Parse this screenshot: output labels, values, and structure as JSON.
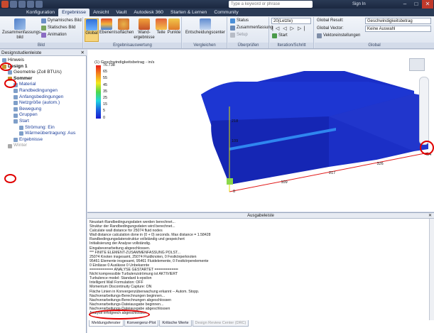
{
  "titlebar": {
    "search_placeholder": "Type a keyword or phrase",
    "signin": "Sign In",
    "win_buttons": [
      "–",
      "□",
      "✕"
    ]
  },
  "tabs": [
    "Konfiguration",
    "Ergebnisse",
    "Ansicht",
    "Vault",
    "Autodesk 360",
    "Starten & Lernen",
    "Community"
  ],
  "ribbon": {
    "bild": {
      "big": "Zusammenfassungs-bild",
      "small": [
        "Dynamisches Bild",
        "Statisches Bild",
        "Animation"
      ],
      "label": "Bild"
    },
    "ergebnis": {
      "buttons": [
        "Global",
        "Ebenen",
        "Isoflächen",
        "Wand-ergebnisse",
        "Teile",
        "Punkte"
      ],
      "label": "Ergebnisauswertung"
    },
    "vergleichen": {
      "button": "Entscheidungscenter",
      "label": "Vergleichen"
    },
    "ueberpruefen": {
      "items": [
        "Status",
        "Zusammenfassung",
        "Setup"
      ],
      "label": "Überprüfen"
    },
    "iteration": {
      "select": "20(Letzte)",
      "start": "Start",
      "label": "Iteration/Schritt"
    },
    "global": {
      "result_label": "Global Result:",
      "result_value": "Geschwindigkeitsbetrag",
      "vector_label": "Global Vector:",
      "vector_value": "Keine Auswahl",
      "settings": "Vektoreinstellungen",
      "label": "Global"
    }
  },
  "design_panel": {
    "title": "Designstudienleiste",
    "tree": [
      {
        "label": "Hinweis",
        "indent": 0
      },
      {
        "label": "Design 1",
        "indent": 0,
        "bold": true
      },
      {
        "label": "Geometrie (Zoll BTU/s)",
        "indent": 1
      },
      {
        "label": "Sommer",
        "indent": 1,
        "bold": true
      },
      {
        "label": "Material",
        "indent": 2,
        "blue": true
      },
      {
        "label": "Randbedingungen",
        "indent": 2,
        "blue": true
      },
      {
        "label": "Anfangsbedingungen",
        "indent": 2,
        "blue": true
      },
      {
        "label": "Netzgröße (autom.)",
        "indent": 2,
        "blue": true
      },
      {
        "label": "Bewegung",
        "indent": 2,
        "blue": true
      },
      {
        "label": "Gruppen",
        "indent": 2,
        "blue": true
      },
      {
        "label": "Start",
        "indent": 2,
        "blue": true
      },
      {
        "label": "Strömung: Ein",
        "indent": 3,
        "blue": true
      },
      {
        "label": "Wärmeübertragung: Aus",
        "indent": 3,
        "blue": true
      },
      {
        "label": "Ergebnisse",
        "indent": 2,
        "blue": true
      },
      {
        "label": "Winter",
        "indent": 1,
        "grey": true
      }
    ]
  },
  "viewport": {
    "legend_title": "(1) Geschwindigkeitsbetrag - in/s",
    "legend_values": [
      "76.738",
      "65",
      "55",
      "45",
      "35",
      "25",
      "15",
      "5",
      "0"
    ],
    "dimensions": [
      "0",
      "109",
      "217",
      "326",
      "434"
    ],
    "vertical_dims": [
      "218",
      "109"
    ]
  },
  "output": {
    "title": "Ausgabeleiste",
    "lines": [
      "Neustart-Randbedingungsdaten werden berechnet...",
      "Struktur der Randbedingungsdaten wird berechnet...",
      "Calculate wall distance for 25074 fluid nodes",
      "Wall distance calculation done in (0 + 0) seconds. Max distance = 1.58428",
      "Randbedingungsdatenstruktur vollständig und gespeichert",
      "Initialisierung der Analyse vollständig.",
      "Eingabeverarbeitung abgeschlossen.",
      "*** FINITE ELEMENT-ZUSAMMENFASSUNG POLST...",
      "  25074 Knoten insgesamt,  25074 Fluidknoten,   0 Festkörperknoten",
      "  95461 Elemente insgesamt,  95461 Fluidelemente,   0 Festkörperelemente",
      "  0 Einlässe   0 Auslässe   0 Unbekannte",
      "  =========== ANALYSE GESTARTET ===========",
      "Nicht kompressible Turbulenzströmung ist AKTIVIERT",
      "  Turbulence model: Standard k-epsilon",
      "    Intelligent Wall Formulation: OFF",
      "    Momentum Discontinuity Capture: ON",
      "Fläche Linien in Konvergenzüberwachung erkannt -- Autom. Stopp.",
      "Nachverarbeitungs-Berechnungen beginnen...",
      "Nachverarbeitungs-Berechnungen abgeschlossen",
      "Nachverarbeitungs-Dateiausgabe beginnen...",
      "Nachverarbeitungs-Dateiausgabe abgeschlossen",
      "Analyse erfolgreich abgeschlossen"
    ],
    "tabs": [
      "Meldungsfenster",
      "Konvergenz-Plot",
      "Kritische Werte",
      "Design Review Center (DRC)"
    ]
  }
}
